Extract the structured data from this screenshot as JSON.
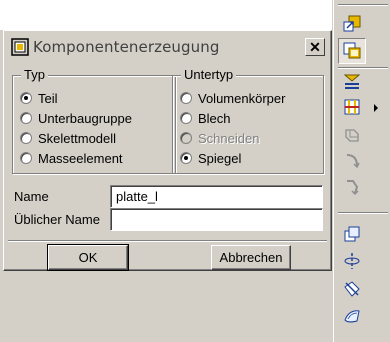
{
  "dialog": {
    "title": "Komponentenerzeugung",
    "close_label": "✕",
    "typ": {
      "label": "Typ",
      "options": [
        {
          "label": "Teil",
          "selected": true,
          "disabled": false
        },
        {
          "label": "Unterbaugruppe",
          "selected": false,
          "disabled": false
        },
        {
          "label": "Skelettmodell",
          "selected": false,
          "disabled": false
        },
        {
          "label": "Masseelement",
          "selected": false,
          "disabled": false
        }
      ]
    },
    "untertyp": {
      "label": "Untertyp",
      "options": [
        {
          "label": "Volumenkörper",
          "selected": false,
          "disabled": false
        },
        {
          "label": "Blech",
          "selected": false,
          "disabled": false
        },
        {
          "label": "Schneiden",
          "selected": false,
          "disabled": true
        },
        {
          "label": "Spiegel",
          "selected": true,
          "disabled": false
        }
      ]
    },
    "name_label": "Name",
    "name_value": "platte_l",
    "ublicher_name_label": "Üblicher Name",
    "ublicher_name_value": "",
    "ok_label": "OK",
    "cancel_label": "Abbrechen"
  },
  "toolbar": {
    "icons": [
      "assemble-icon",
      "create-component-icon",
      "pattern-icon",
      "section-icon",
      "repeat-icon",
      "merge-icon",
      "cutout-icon",
      "datum-plane-icon",
      "datum-axis-icon",
      "datum-point-icon",
      "surface-icon"
    ],
    "accent": "#e8b800"
  }
}
